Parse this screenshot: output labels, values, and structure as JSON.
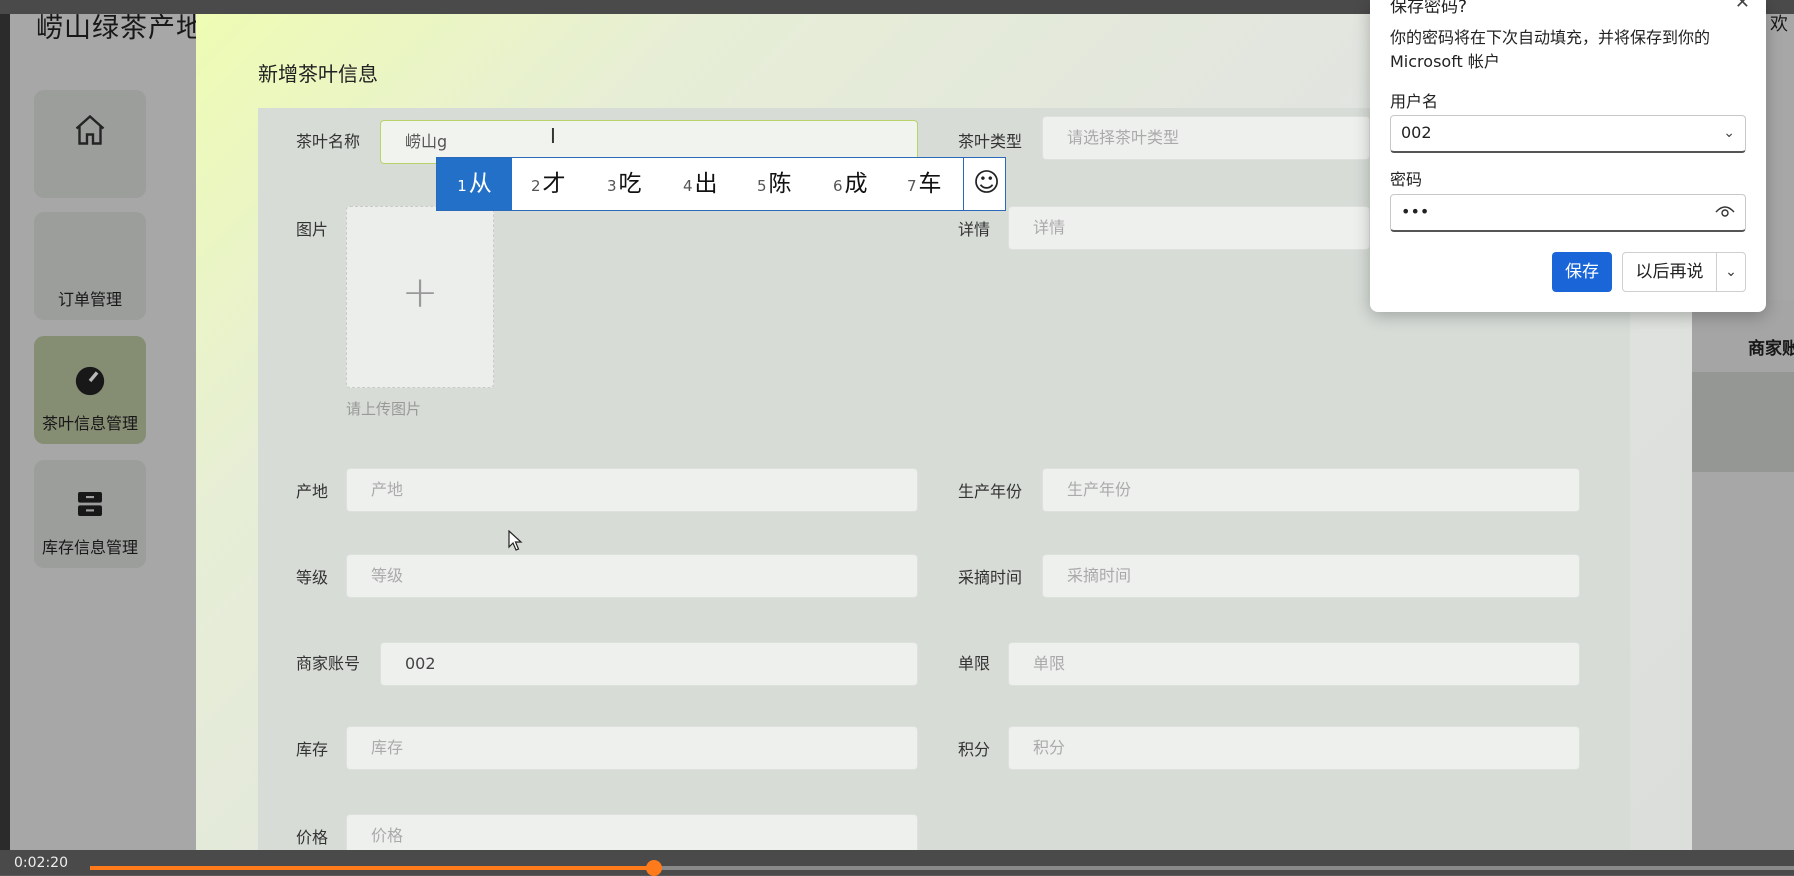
{
  "app": {
    "title": "崂山绿茶产地",
    "welcome": "欢",
    "sidebar": [
      {
        "label": "",
        "icon": "home-icon"
      },
      {
        "label": "订单管理",
        "icon": ""
      },
      {
        "label": "茶叶信息管理",
        "icon": "gauge-icon"
      },
      {
        "label": "库存信息管理",
        "icon": "archive-icon"
      }
    ],
    "right_header": "商家账"
  },
  "dialog": {
    "title": "新增茶叶信息",
    "fields": {
      "name": {
        "label": "茶叶名称",
        "value": "崂山g"
      },
      "type": {
        "label": "茶叶类型",
        "placeholder": "请选择茶叶类型"
      },
      "image": {
        "label": "图片",
        "tip": "请上传图片",
        "plus": "+"
      },
      "detail": {
        "label": "详情",
        "placeholder": "详情"
      },
      "origin": {
        "label": "产地",
        "placeholder": "产地"
      },
      "year": {
        "label": "生产年份",
        "placeholder": "生产年份"
      },
      "grade": {
        "label": "等级",
        "placeholder": "等级"
      },
      "pick_time": {
        "label": "采摘时间",
        "placeholder": "采摘时间"
      },
      "merchant": {
        "label": "商家账号",
        "value": "002"
      },
      "limit": {
        "label": "单限",
        "placeholder": "单限"
      },
      "stock": {
        "label": "库存",
        "placeholder": "库存"
      },
      "points": {
        "label": "积分",
        "placeholder": "积分"
      },
      "price": {
        "label": "价格",
        "placeholder": "价格"
      }
    }
  },
  "ime": {
    "candidates": [
      {
        "n": "1",
        "c": "从"
      },
      {
        "n": "2",
        "c": "才"
      },
      {
        "n": "3",
        "c": "吃"
      },
      {
        "n": "4",
        "c": "出"
      },
      {
        "n": "5",
        "c": "陈"
      },
      {
        "n": "6",
        "c": "成"
      },
      {
        "n": "7",
        "c": "车"
      }
    ],
    "emoji": "☺"
  },
  "password_prompt": {
    "title": "保存密码?",
    "close": "✕",
    "description": "你的密码将在下次自动填充，并将保存到你的 Microsoft 帐户",
    "username_label": "用户名",
    "username_value": "002",
    "password_label": "密码",
    "password_value": "•••",
    "save_label": "保存",
    "later_label": "以后再说"
  },
  "video": {
    "time": "0:02:20",
    "progress_fraction": 0.331
  },
  "colors": {
    "accent_orange": "#ff7a1a",
    "save_blue": "#1a66d8",
    "ime_highlight": "#2370c9"
  }
}
